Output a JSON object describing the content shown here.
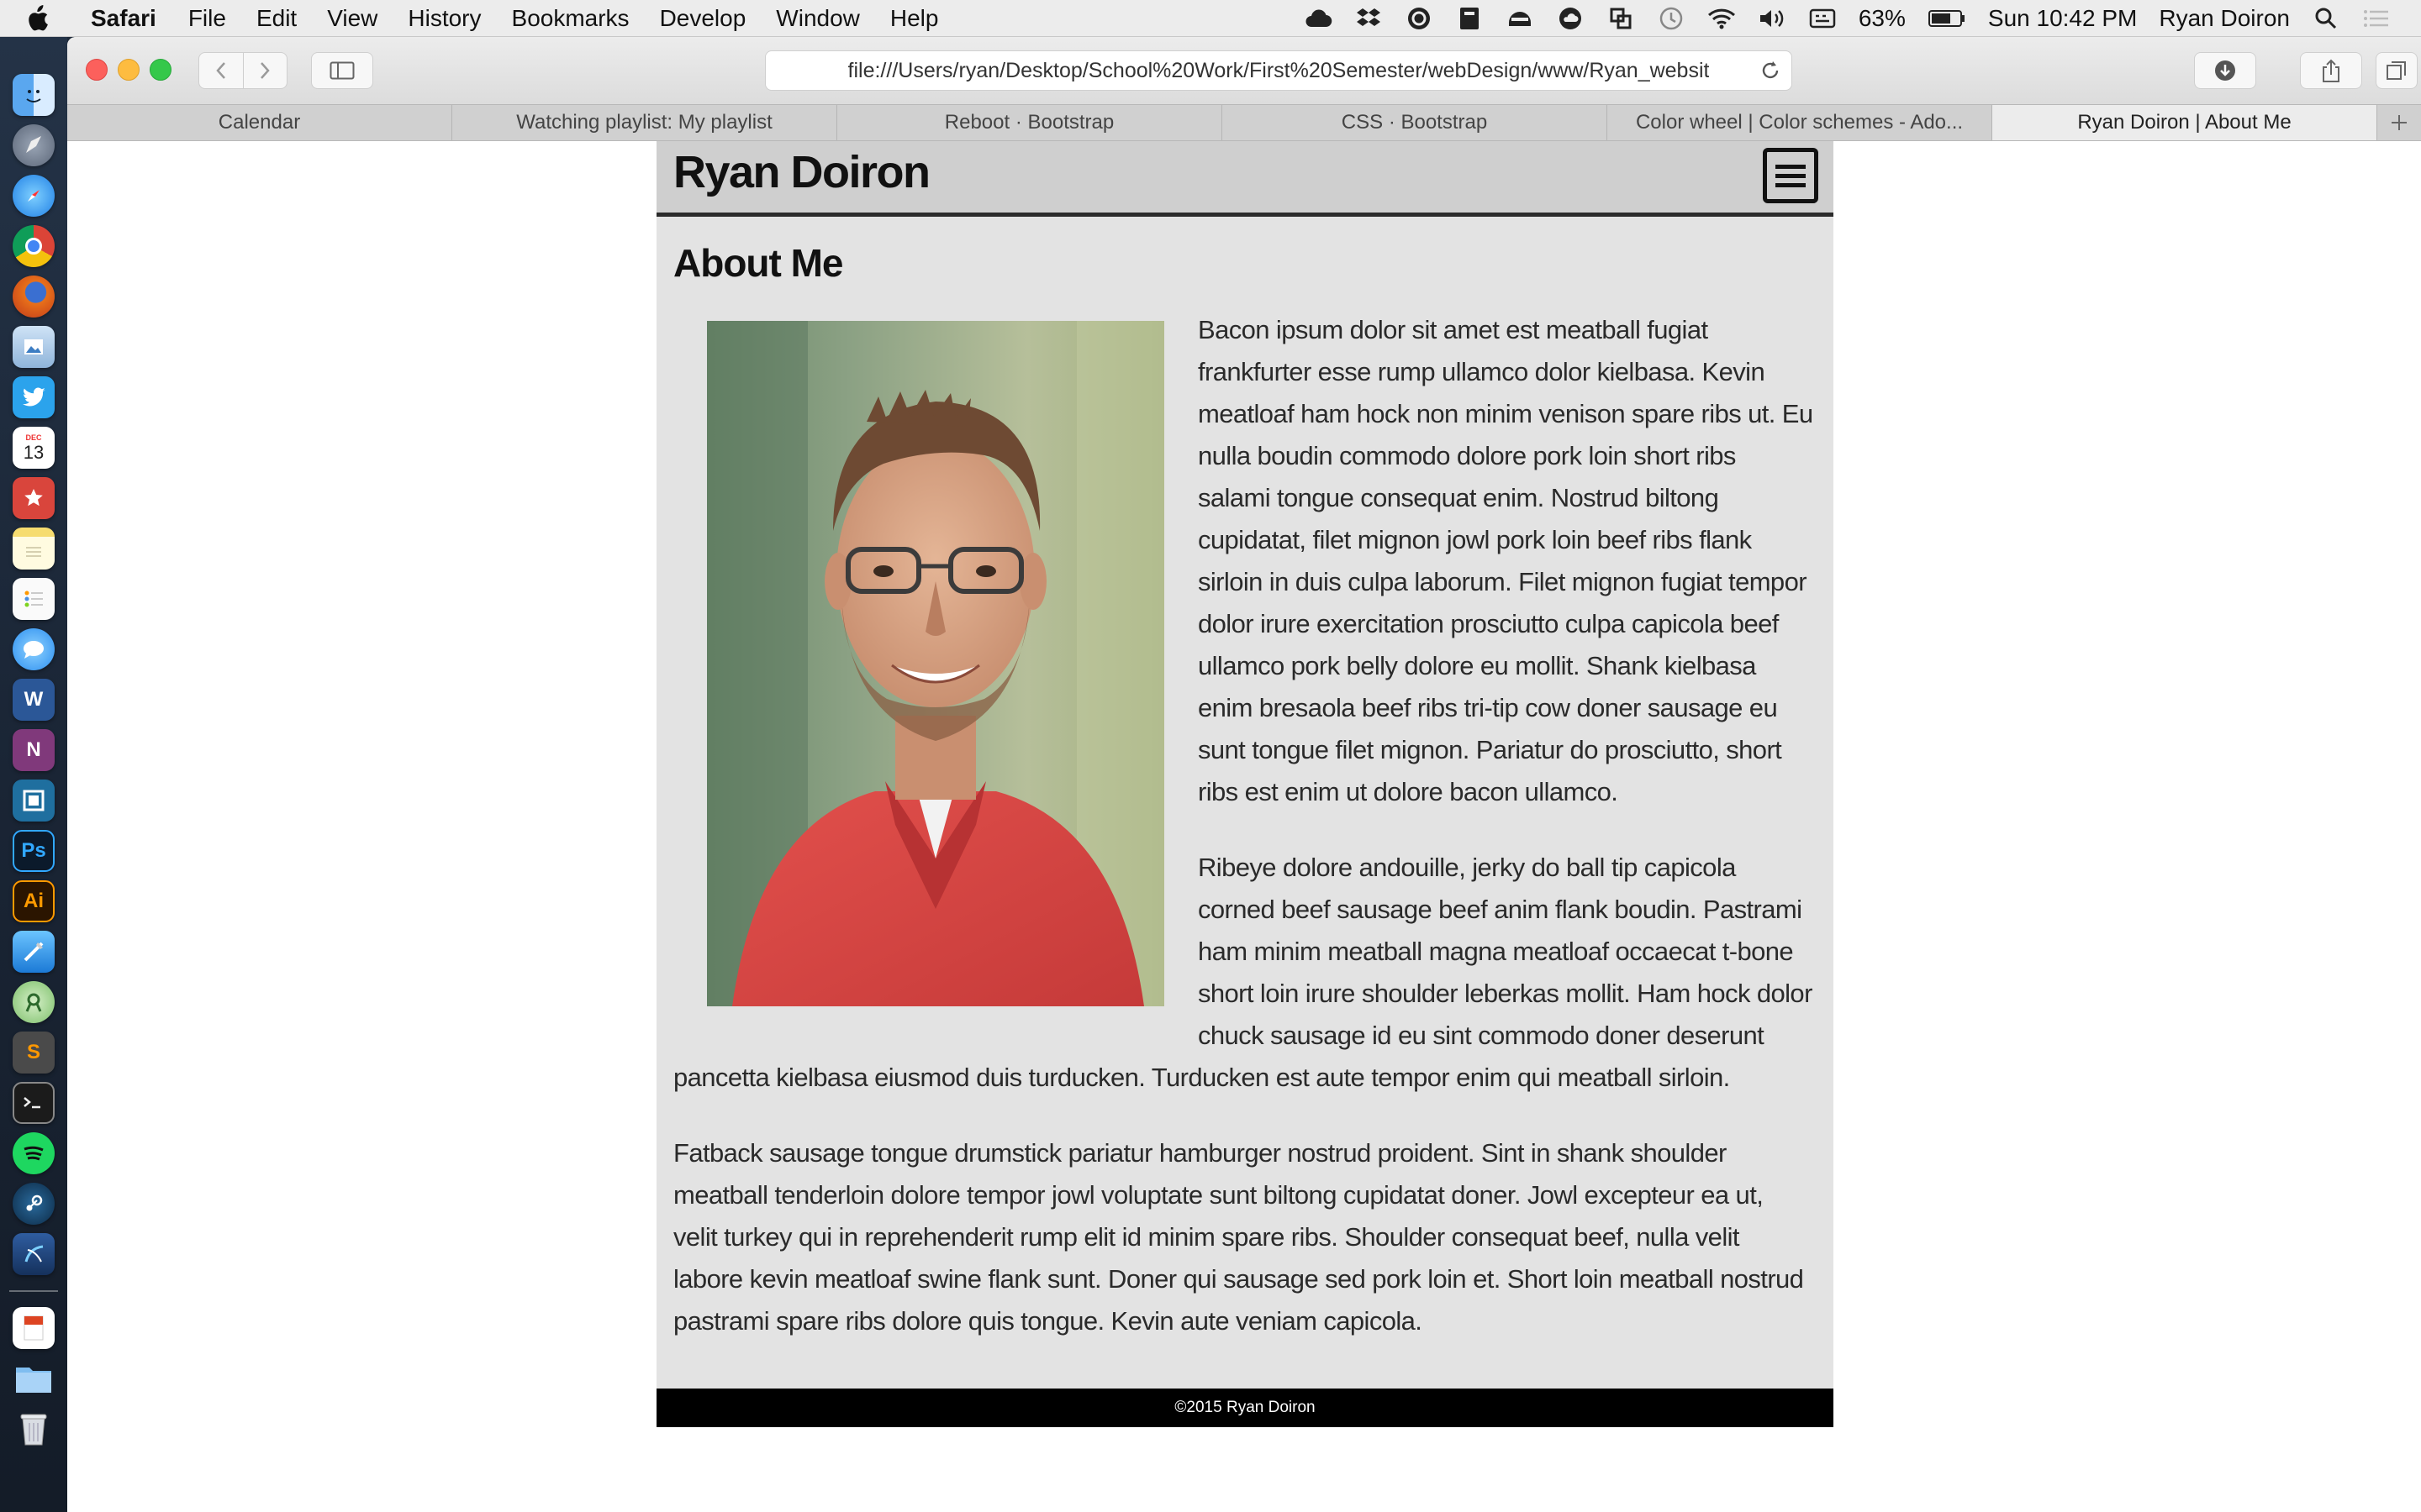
{
  "menubar": {
    "app_name": "Safari",
    "items": [
      "File",
      "Edit",
      "View",
      "History",
      "Bookmarks",
      "Develop",
      "Window",
      "Help"
    ],
    "battery": "63%",
    "clock": "Sun 10:42 PM",
    "user": "Ryan Doiron"
  },
  "dock": {
    "calendar_day": "13",
    "calendar_month": "DEC",
    "word_letter": "W",
    "onenote_letter": "N",
    "photoshop_letter": "Ps",
    "illustrator_letter": "Ai",
    "sublime_letter": "S"
  },
  "browser": {
    "address": "file:///Users/ryan/Desktop/School%20Work/First%20Semester/webDesign/www/Ryan_websit",
    "tabs": [
      {
        "label": "Calendar"
      },
      {
        "label": "Watching playlist: My playlist"
      },
      {
        "label": "Reboot · Bootstrap"
      },
      {
        "label": "CSS · Bootstrap"
      },
      {
        "label": "Color wheel | Color schemes - Ado..."
      },
      {
        "label": "Ryan Doiron | About Me"
      }
    ]
  },
  "site": {
    "title": "Ryan Doiron",
    "heading": "About Me",
    "paragraphs": [
      "Bacon ipsum dolor sit amet est meatball fugiat frankfurter esse rump ullamco dolor kielbasa. Kevin meatloaf ham hock non minim venison spare ribs ut. Eu nulla boudin commodo dolore pork loin short ribs salami tongue consequat enim. Nostrud biltong cupidatat, filet mignon jowl pork loin beef ribs flank sirloin in duis culpa laborum. Filet mignon fugiat tempor dolor irure exercitation prosciutto culpa capicola beef ullamco pork belly dolore eu mollit. Shank kielbasa enim bresaola beef ribs tri-tip cow doner sausage eu sunt tongue filet mignon. Pariatur do prosciutto, short ribs est enim ut dolore bacon ullamco.",
      "Ribeye dolore andouille, jerky do ball tip capicola corned beef sausage beef anim flank boudin. Pastrami ham minim meatball magna meatloaf occaecat t-bone short loin irure shoulder leberkas mollit. Ham hock dolor chuck sausage id eu sint commodo doner deserunt pancetta kielbasa eiusmod duis turducken. Turducken est aute tempor enim qui meatball sirloin.",
      "Fatback sausage tongue drumstick pariatur hamburger nostrud proident. Sint in shank shoulder meatball tenderloin dolore tempor jowl voluptate sunt biltong cupidatat doner. Jowl excepteur ea ut, velit turkey qui in reprehenderit rump elit id minim spare ribs. Shoulder consequat beef, nulla velit labore kevin meatloaf swine flank sunt. Doner qui sausage sed pork loin et. Short loin meatball nostrud pastrami spare ribs dolore quis tongue. Kevin aute veniam capicola."
    ],
    "footer": "©2015 Ryan Doiron"
  }
}
